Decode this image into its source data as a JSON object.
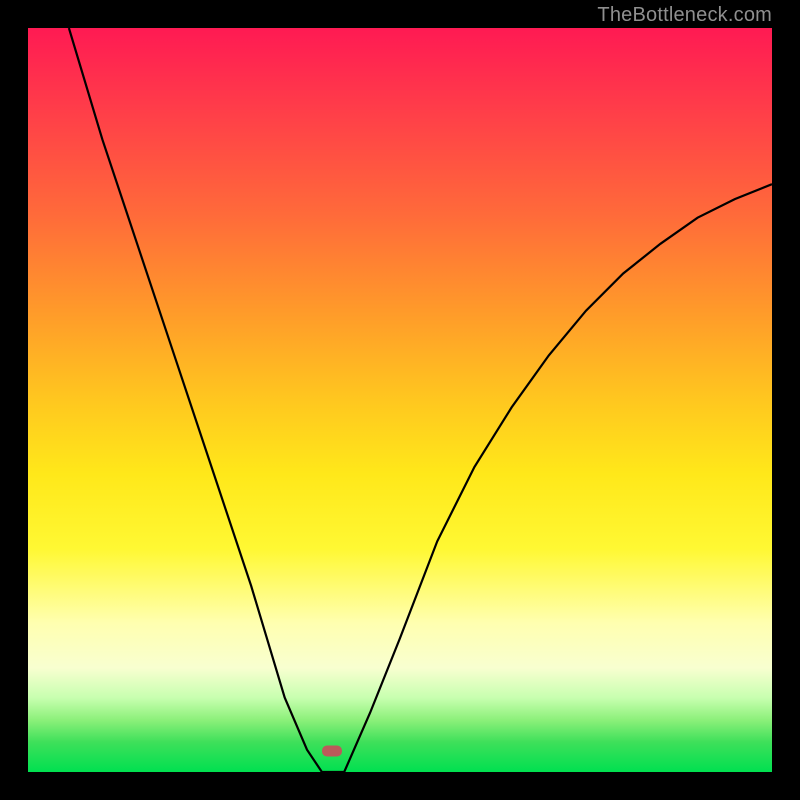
{
  "watermark": "TheBottleneck.com",
  "colors": {
    "frame": "#000000",
    "gradient_top": "#ff1a53",
    "gradient_bottom": "#00e050",
    "curve": "#000000",
    "marker": "#bb5a5a",
    "watermark_text": "#8f8f8f"
  },
  "marker": {
    "x_frac": 0.409,
    "y_frac": 0.972
  },
  "chart_data": {
    "type": "line",
    "title": "",
    "xlabel": "",
    "ylabel": "",
    "xlim": [
      0,
      1
    ],
    "ylim": [
      0,
      1
    ],
    "curve_left": {
      "description": "Left branch: descends from top-left toward notch; y ≈ bottleneck%, x ≈ component balance",
      "x": [
        0.055,
        0.1,
        0.15,
        0.2,
        0.25,
        0.3,
        0.345,
        0.375,
        0.395
      ],
      "y": [
        1.0,
        0.85,
        0.7,
        0.55,
        0.4,
        0.25,
        0.1,
        0.03,
        0.0
      ]
    },
    "curve_right": {
      "description": "Right branch: rises from notch toward upper-right with decreasing slope",
      "x": [
        0.425,
        0.46,
        0.5,
        0.55,
        0.6,
        0.65,
        0.7,
        0.75,
        0.8,
        0.85,
        0.9,
        0.95,
        1.0
      ],
      "y": [
        0.0,
        0.08,
        0.18,
        0.31,
        0.41,
        0.49,
        0.56,
        0.62,
        0.67,
        0.71,
        0.745,
        0.77,
        0.79
      ]
    },
    "notch": {
      "x_start": 0.395,
      "x_end": 0.425,
      "y": 0.0
    },
    "optimum_marker": {
      "x": 0.409,
      "y": 0.0
    }
  }
}
